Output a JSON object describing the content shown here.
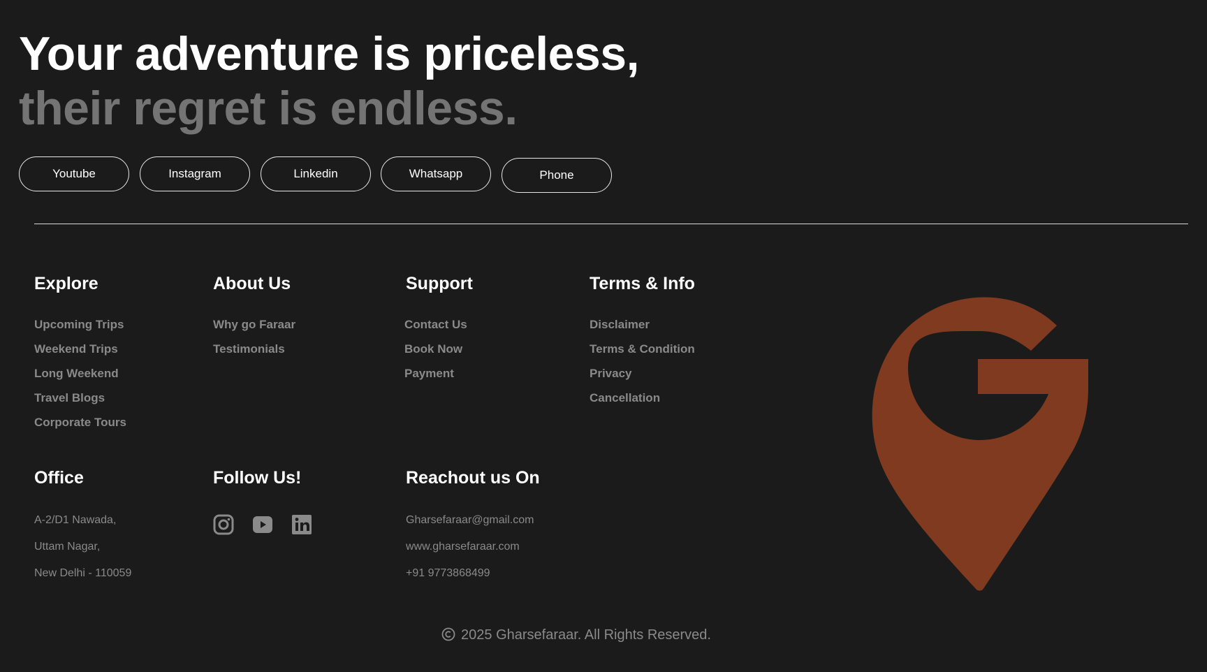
{
  "hero": {
    "line1": "Your adventure is priceless,",
    "line2": "their regret is endless."
  },
  "pills": [
    {
      "label": "Youtube"
    },
    {
      "label": "Instagram"
    },
    {
      "label": "Linkedin"
    },
    {
      "label": "Whatsapp"
    },
    {
      "label": "Phone"
    }
  ],
  "explore": {
    "title": "Explore",
    "links": [
      "Upcoming Trips",
      "Weekend Trips",
      "Long Weekend",
      "Travel Blogs",
      "Corporate Tours"
    ]
  },
  "about": {
    "title": "About Us",
    "links": [
      "Why go Faraar",
      "Testimonials"
    ]
  },
  "support": {
    "title": "Support",
    "links": [
      "Contact Us",
      "Book Now",
      "Payment"
    ]
  },
  "terms": {
    "title": "Terms & Info",
    "links": [
      "Disclaimer",
      "Terms & Condition",
      "Privacy",
      "Cancellation"
    ]
  },
  "office": {
    "title": "Office",
    "lines": [
      "A-2/D1 Nawada,",
      "Uttam Nagar,",
      "New Delhi - 110059"
    ]
  },
  "follow": {
    "title": "Follow Us!",
    "icons": [
      "instagram-icon",
      "youtube-icon",
      "linkedin-icon"
    ]
  },
  "reach": {
    "title": "Reachout us On",
    "lines": [
      "Gharsefaraar@gmail.com",
      "www.gharsefaraar.com",
      "+91 9773868499"
    ]
  },
  "footer": {
    "copyright": "2025 Gharsefaraar. All Rights Reserved."
  },
  "colors": {
    "background": "#1b1b1b",
    "muted_text": "#8a8a8a",
    "headline_secondary": "#747474",
    "brand": "#7f3a20"
  }
}
